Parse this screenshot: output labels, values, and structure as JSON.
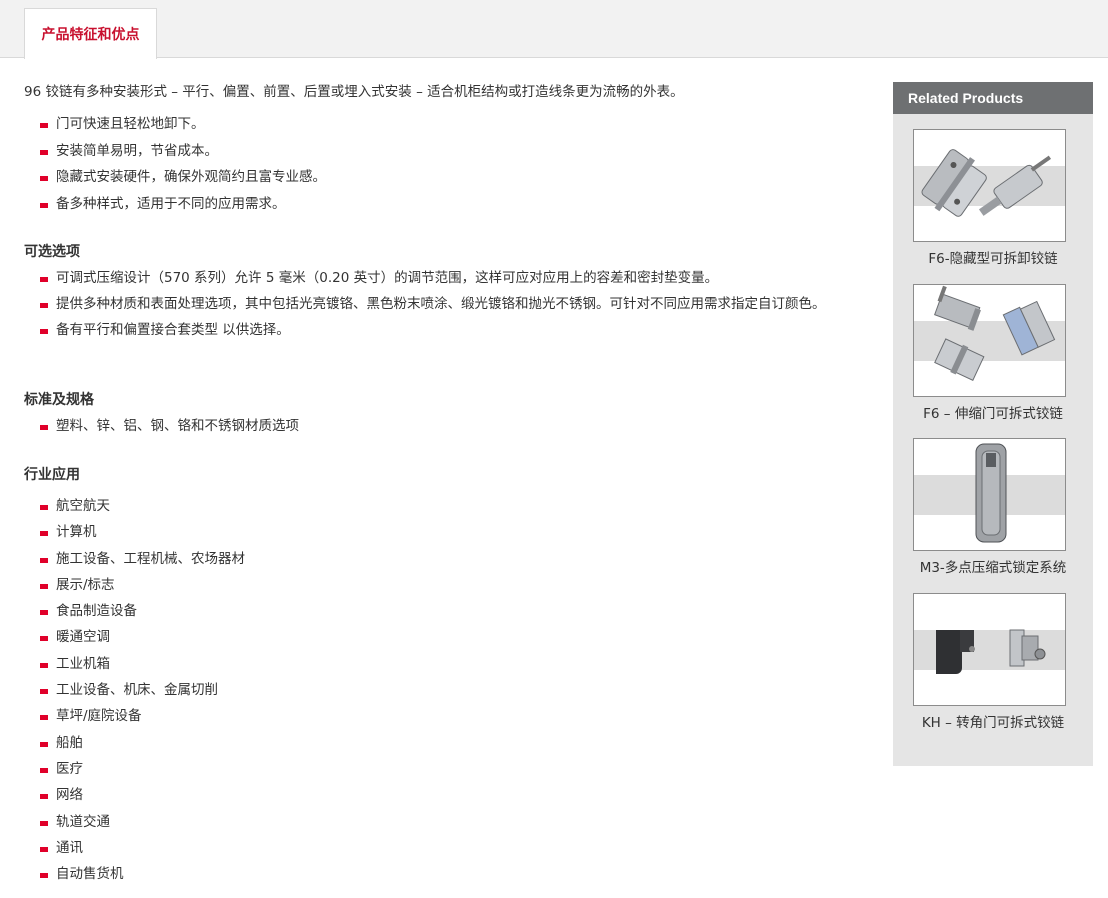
{
  "tabs": {
    "active_label": "产品特征和优点"
  },
  "intro": "96 铰链有多种安装形式 – 平行、偏置、前置、后置或埋入式安装 – 适合机柜结构或打造线条更为流畅的外表。",
  "features": [
    "门可快速且轻松地卸下。",
    "安装简单易明，节省成本。",
    "隐藏式安装硬件，确保外观简约且富专业感。",
    "备多种样式，适用于不同的应用需求。"
  ],
  "options": {
    "title": "可选选项",
    "items": [
      "可调式压缩设计（570 系列）允许 5 毫米（0.20 英寸）的调节范围，这样可应对应用上的容差和密封垫变量。",
      "提供多种材质和表面处理选项，其中包括光亮镀铬、黑色粉末喷涂、缎光镀铬和抛光不锈钢。可针对不同应用需求指定自订颜色。",
      "备有平行和偏置接合套类型 以供选择。"
    ]
  },
  "specs": {
    "title": "标准及规格",
    "items": [
      "塑料、锌、铝、钢、铬和不锈钢材质选项"
    ]
  },
  "industries": {
    "title": "行业应用",
    "items": [
      "航空航天",
      "计算机",
      "施工设备、工程机械、农场器材",
      "展示/标志",
      "食品制造设备",
      "暖通空调",
      "工业机箱",
      "工业设备、机床、金属切削",
      "草坪/庭院设备",
      "船舶",
      "医疗",
      "网络",
      "轨道交通",
      "通讯",
      "自动售货机"
    ]
  },
  "related": {
    "title": "Related Products",
    "products": [
      {
        "caption": "F6-隐藏型可拆卸铰链",
        "icon": "concealed-hinge-photo"
      },
      {
        "caption": "F6 – 伸缩门可拆式铰链",
        "icon": "lift-off-hinge-photo"
      },
      {
        "caption": "M3-多点压缩式锁定系统",
        "icon": "compression-latch-photo"
      },
      {
        "caption": "KH – 转角门可拆式铰链",
        "icon": "corner-hinge-photo"
      }
    ]
  },
  "colors": {
    "accent": "#c8102e",
    "bullet": "#e0002a",
    "sidebar_head": "#6e7072",
    "sidebar_bg": "#e5e5e5"
  }
}
